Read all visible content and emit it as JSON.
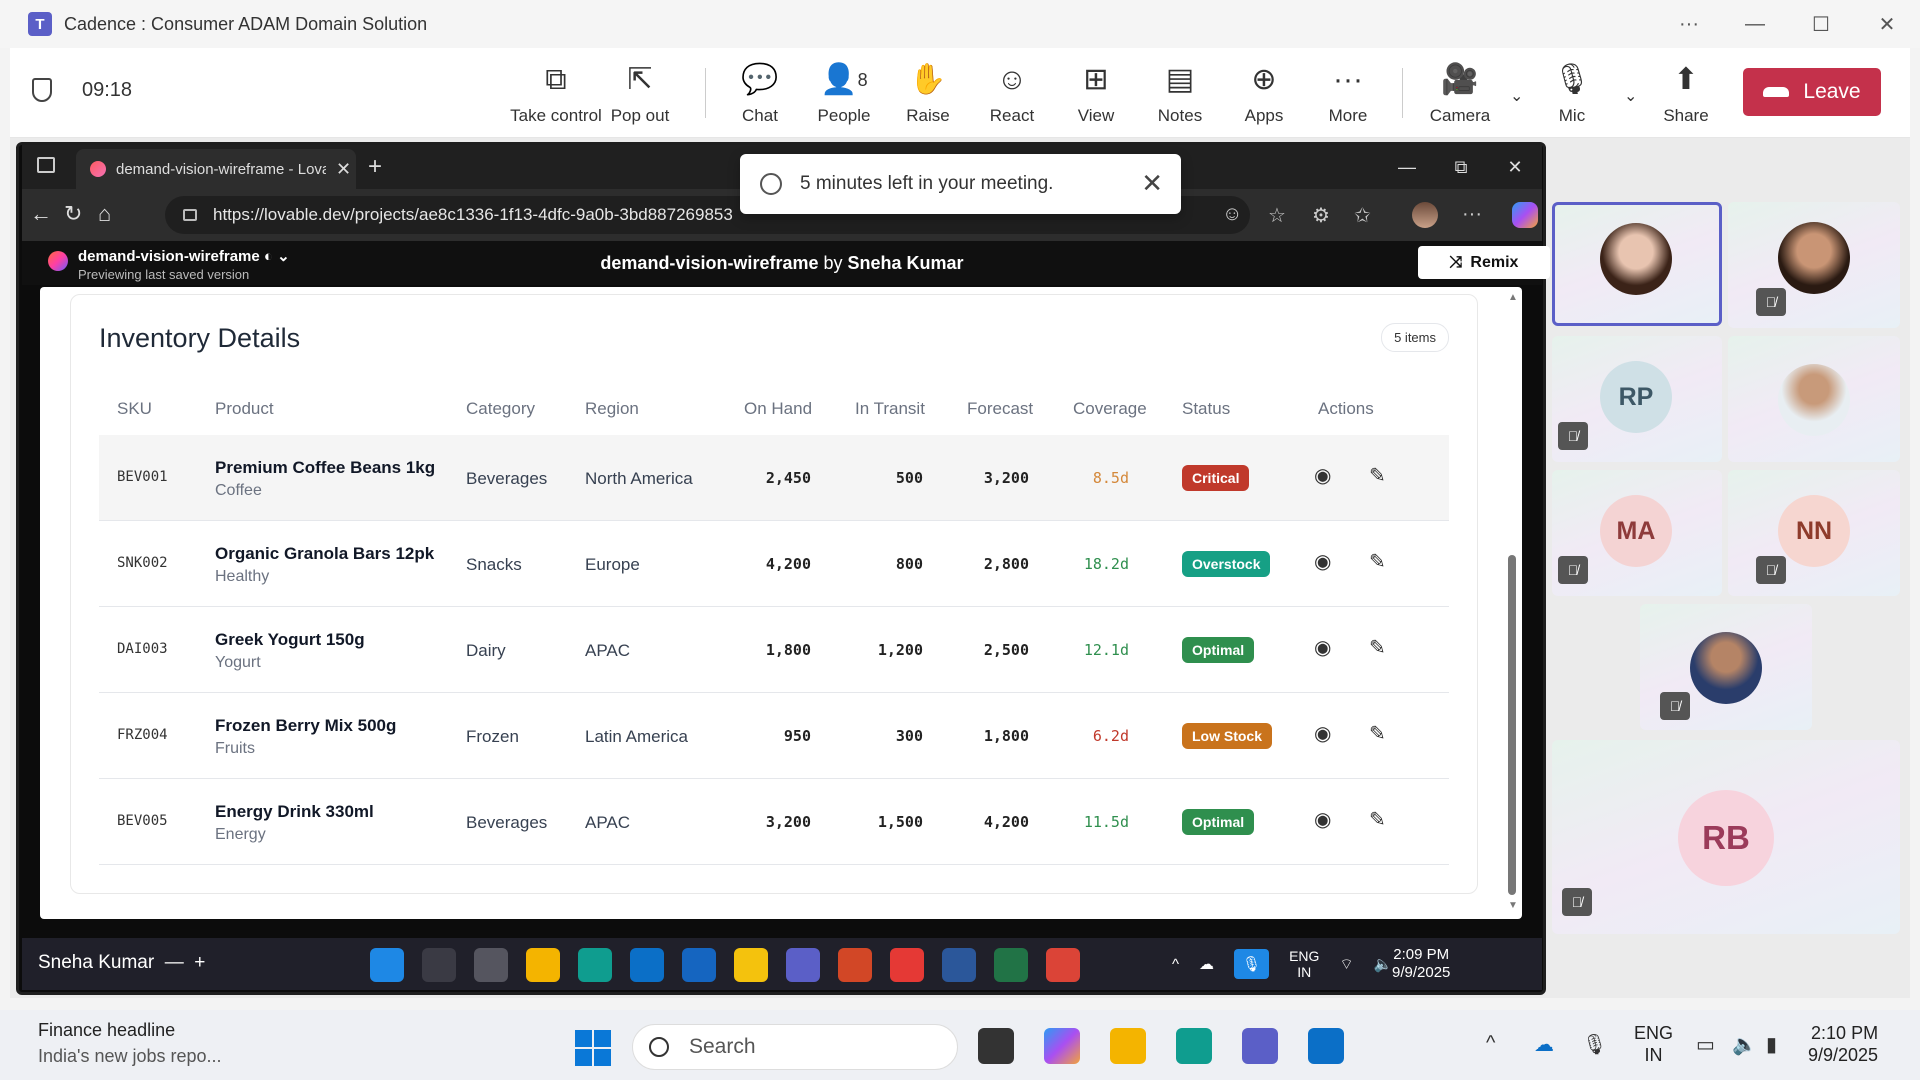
{
  "teams": {
    "window_title": "Cadence : Consumer ADAM Domain Solution",
    "timer": "09:18",
    "toolbar": {
      "take_control": "Take control",
      "pop_out": "Pop out",
      "chat": "Chat",
      "people": "People",
      "people_count": "8",
      "raise": "Raise",
      "react": "React",
      "view": "View",
      "notes": "Notes",
      "apps": "Apps",
      "more": "More",
      "camera": "Camera",
      "mic": "Mic",
      "share": "Share",
      "leave": "Leave"
    },
    "toast": "5 minutes left in your meeting.",
    "participants": [
      "RP",
      "MA",
      "NN",
      "RB"
    ]
  },
  "browser": {
    "tab_title": "demand-vision-wireframe - Lovable",
    "url": "https://lovable.dev/projects/ae8c1336-1f13-4dfc-9a0b-3bd887269853"
  },
  "lovable": {
    "project_name": "demand-vision-wireframe",
    "preview_note": "Previewing last saved version",
    "header_project": "demand-vision-wireframe",
    "header_by": "by",
    "header_author": "Sneha Kumar",
    "remix": "Remix"
  },
  "inventory": {
    "title": "Inventory Details",
    "badge": "5 items",
    "columns": [
      "SKU",
      "Product",
      "Category",
      "Region",
      "On Hand",
      "In Transit",
      "Forecast",
      "Coverage",
      "Status",
      "Actions"
    ],
    "rows": [
      {
        "sku": "BEV001",
        "product": "Premium Coffee Beans 1kg",
        "sub": "Coffee",
        "category": "Beverages",
        "region": "North America",
        "on_hand": "2,450",
        "in_transit": "500",
        "forecast": "3,200",
        "coverage": "8.5d",
        "status": "Critical"
      },
      {
        "sku": "SNK002",
        "product": "Organic Granola Bars 12pk",
        "sub": "Healthy",
        "category": "Snacks",
        "region": "Europe",
        "on_hand": "4,200",
        "in_transit": "800",
        "forecast": "2,800",
        "coverage": "18.2d",
        "status": "Overstock"
      },
      {
        "sku": "DAI003",
        "product": "Greek Yogurt 150g",
        "sub": "Yogurt",
        "category": "Dairy",
        "region": "APAC",
        "on_hand": "1,800",
        "in_transit": "1,200",
        "forecast": "2,500",
        "coverage": "12.1d",
        "status": "Optimal"
      },
      {
        "sku": "FRZ004",
        "product": "Frozen Berry Mix 500g",
        "sub": "Fruits",
        "category": "Frozen",
        "region": "Latin America",
        "on_hand": "950",
        "in_transit": "300",
        "forecast": "1,800",
        "coverage": "6.2d",
        "status": "Low Stock"
      },
      {
        "sku": "BEV005",
        "product": "Energy Drink 330ml",
        "sub": "Energy",
        "category": "Beverages",
        "region": "APAC",
        "on_hand": "3,200",
        "in_transit": "1,500",
        "forecast": "4,200",
        "coverage": "11.5d",
        "status": "Optimal"
      }
    ],
    "status_colors": {
      "Critical": "#c0392b",
      "Overstock": "#16a085",
      "Optimal": "#2f8f4e",
      "Low Stock": "#c9731c"
    },
    "coverage_colors": {
      "Critical": "#d4883a",
      "Overstock": "#2f8f4e",
      "Optimal": "#2f8f4e",
      "Low Stock": "#c0392b"
    }
  },
  "remote_taskbar": {
    "user": "Sneha Kumar",
    "lang": "ENG",
    "region": "IN",
    "time": "2:09 PM",
    "date": "9/9/2025"
  },
  "taskbar": {
    "headline_title": "Finance headline",
    "headline_text": "India's new jobs repo...",
    "search": "Search",
    "lang": "ENG",
    "region": "IN",
    "time": "2:10 PM",
    "date": "9/9/2025"
  },
  "colors": {
    "teams_accent": "#5b5fc7",
    "leave": "#c4314b"
  }
}
